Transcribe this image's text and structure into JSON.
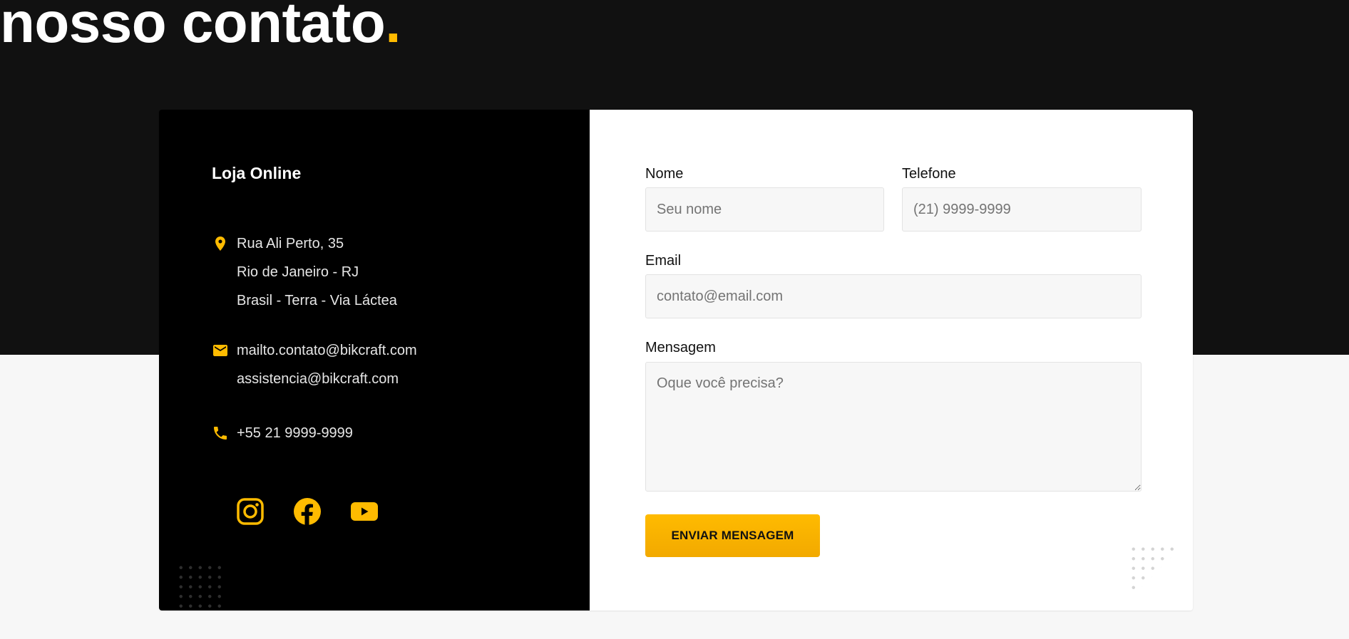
{
  "page": {
    "title": "nosso contato",
    "title_dot": "."
  },
  "colors": {
    "accent": "#ffbb00",
    "dark_band": "#111111",
    "info_panel": "#000000",
    "form_panel": "#ffffff",
    "page_bg": "#f7f7f7"
  },
  "info": {
    "title": "Loja Online",
    "address": [
      "Rua Ali Perto, 35",
      "Rio de Janeiro - RJ",
      "Brasil - Terra - Via Láctea"
    ],
    "emails": [
      "mailto.contato@bikcraft.com",
      "assistencia@bikcraft.com"
    ],
    "phone": "+55 21 9999-9999",
    "icons": {
      "address": "location-pin-icon",
      "email": "mail-icon",
      "phone": "phone-icon"
    },
    "social": [
      {
        "name": "instagram",
        "icon": "instagram-icon"
      },
      {
        "name": "facebook",
        "icon": "facebook-icon"
      },
      {
        "name": "youtube",
        "icon": "youtube-icon"
      }
    ]
  },
  "form": {
    "name_label": "Nome",
    "name_placeholder": "Seu nome",
    "phone_label": "Telefone",
    "phone_placeholder": "(21) 9999-9999",
    "email_label": "Email",
    "email_placeholder": "contato@email.com",
    "message_label": "Mensagem",
    "message_placeholder": "Oque você precisa?",
    "submit_label": "ENVIAR MENSAGEM"
  }
}
